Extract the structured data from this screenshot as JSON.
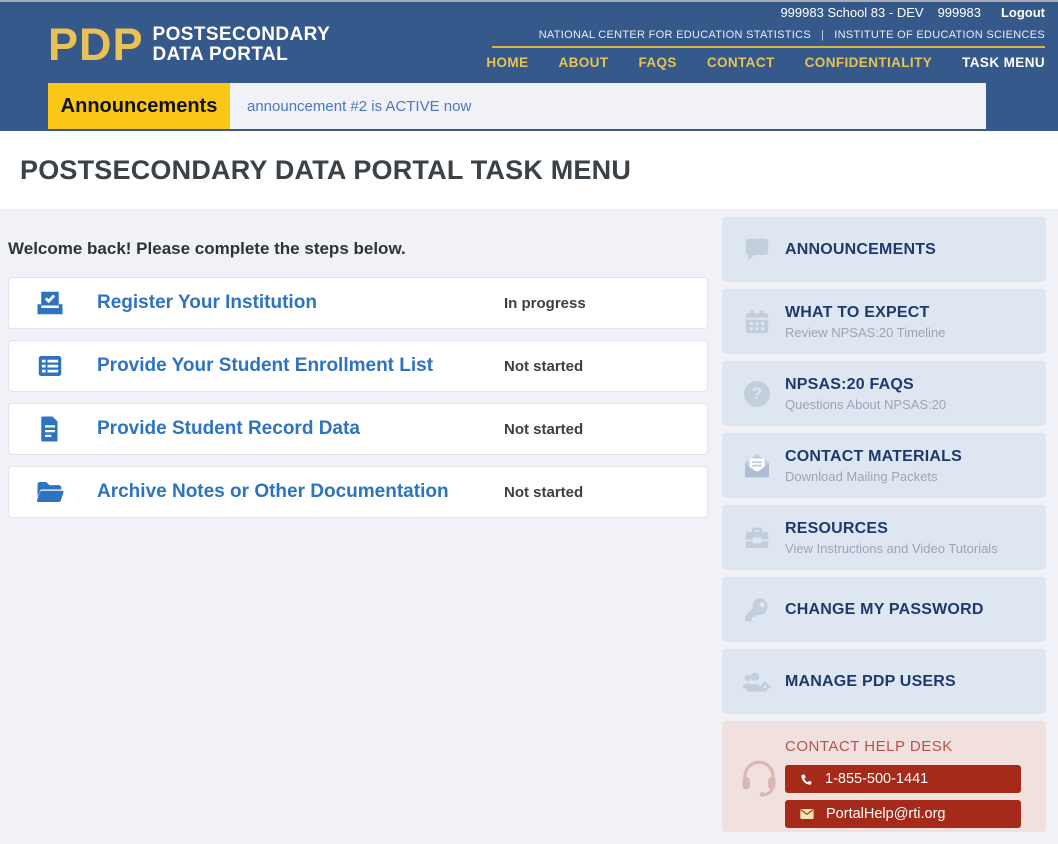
{
  "topbar": {
    "school": "999983 School 83 - DEV",
    "user_id": "999983",
    "logout_label": "Logout"
  },
  "header": {
    "logo_acronym": "PDP",
    "logo_line1": "POSTSECONDARY",
    "logo_line2": "DATA PORTAL",
    "agency_left": "NATIONAL CENTER FOR EDUCATION STATISTICS",
    "agency_separator": "|",
    "agency_right": "INSTITUTE OF EDUCATION SCIENCES",
    "nav": [
      {
        "label": "HOME"
      },
      {
        "label": "ABOUT"
      },
      {
        "label": "FAQS"
      },
      {
        "label": "CONTACT"
      },
      {
        "label": "CONFIDENTIALITY"
      },
      {
        "label": "TASK MENU"
      }
    ]
  },
  "announcements_bar": {
    "label": "Announcements",
    "message": "announcement #2 is ACTIVE now"
  },
  "page": {
    "title": "POSTSECONDARY DATA PORTAL TASK MENU",
    "welcome": "Welcome back! Please complete the steps below."
  },
  "tasks": [
    {
      "title": "Register Your Institution",
      "status": "In progress",
      "icon": "ballot-check-icon"
    },
    {
      "title": "Provide Your Student Enrollment List",
      "status": "Not started",
      "icon": "table-list-icon"
    },
    {
      "title": "Provide Student Record Data",
      "status": "Not started",
      "icon": "file-lines-icon"
    },
    {
      "title": "Archive Notes or Other Documentation",
      "status": "Not started",
      "icon": "folder-open-icon"
    }
  ],
  "sidebar": {
    "items": [
      {
        "title": "ANNOUNCEMENTS",
        "subtitle": "",
        "icon": "comment-icon"
      },
      {
        "title": "WHAT TO EXPECT",
        "subtitle": "Review NPSAS:20 Timeline",
        "icon": "calendar-icon"
      },
      {
        "title": "NPSAS:20 FAQS",
        "subtitle": "Questions About NPSAS:20",
        "icon": "question-circle-icon"
      },
      {
        "title": "CONTACT MATERIALS",
        "subtitle": "Download Mailing Packets",
        "icon": "envelope-open-icon"
      },
      {
        "title": "RESOURCES",
        "subtitle": "View Instructions and Video Tutorials",
        "icon": "toolbox-icon"
      },
      {
        "title": "CHANGE MY PASSWORD",
        "subtitle": "",
        "icon": "key-icon"
      },
      {
        "title": "MANAGE PDP USERS",
        "subtitle": "",
        "icon": "users-gear-icon"
      }
    ],
    "help_desk": {
      "title": "CONTACT HELP DESK",
      "phone": "1-855-500-1441",
      "email": "PortalHelp@rti.org",
      "icon": "headset-icon"
    }
  },
  "colors": {
    "header_blue": "#36598B",
    "gold": "#E6C352",
    "announcement_yellow": "#FBC717",
    "link_blue": "#2E73C2",
    "navy": "#1E3A6D",
    "sidebar_card": "#DEE6F1",
    "sidebar_icon": "#C3CEDD",
    "helpdesk_bg": "#F0E1DF",
    "helpdesk_red": "#A62A19",
    "page_bg": "#F1F2F7"
  }
}
